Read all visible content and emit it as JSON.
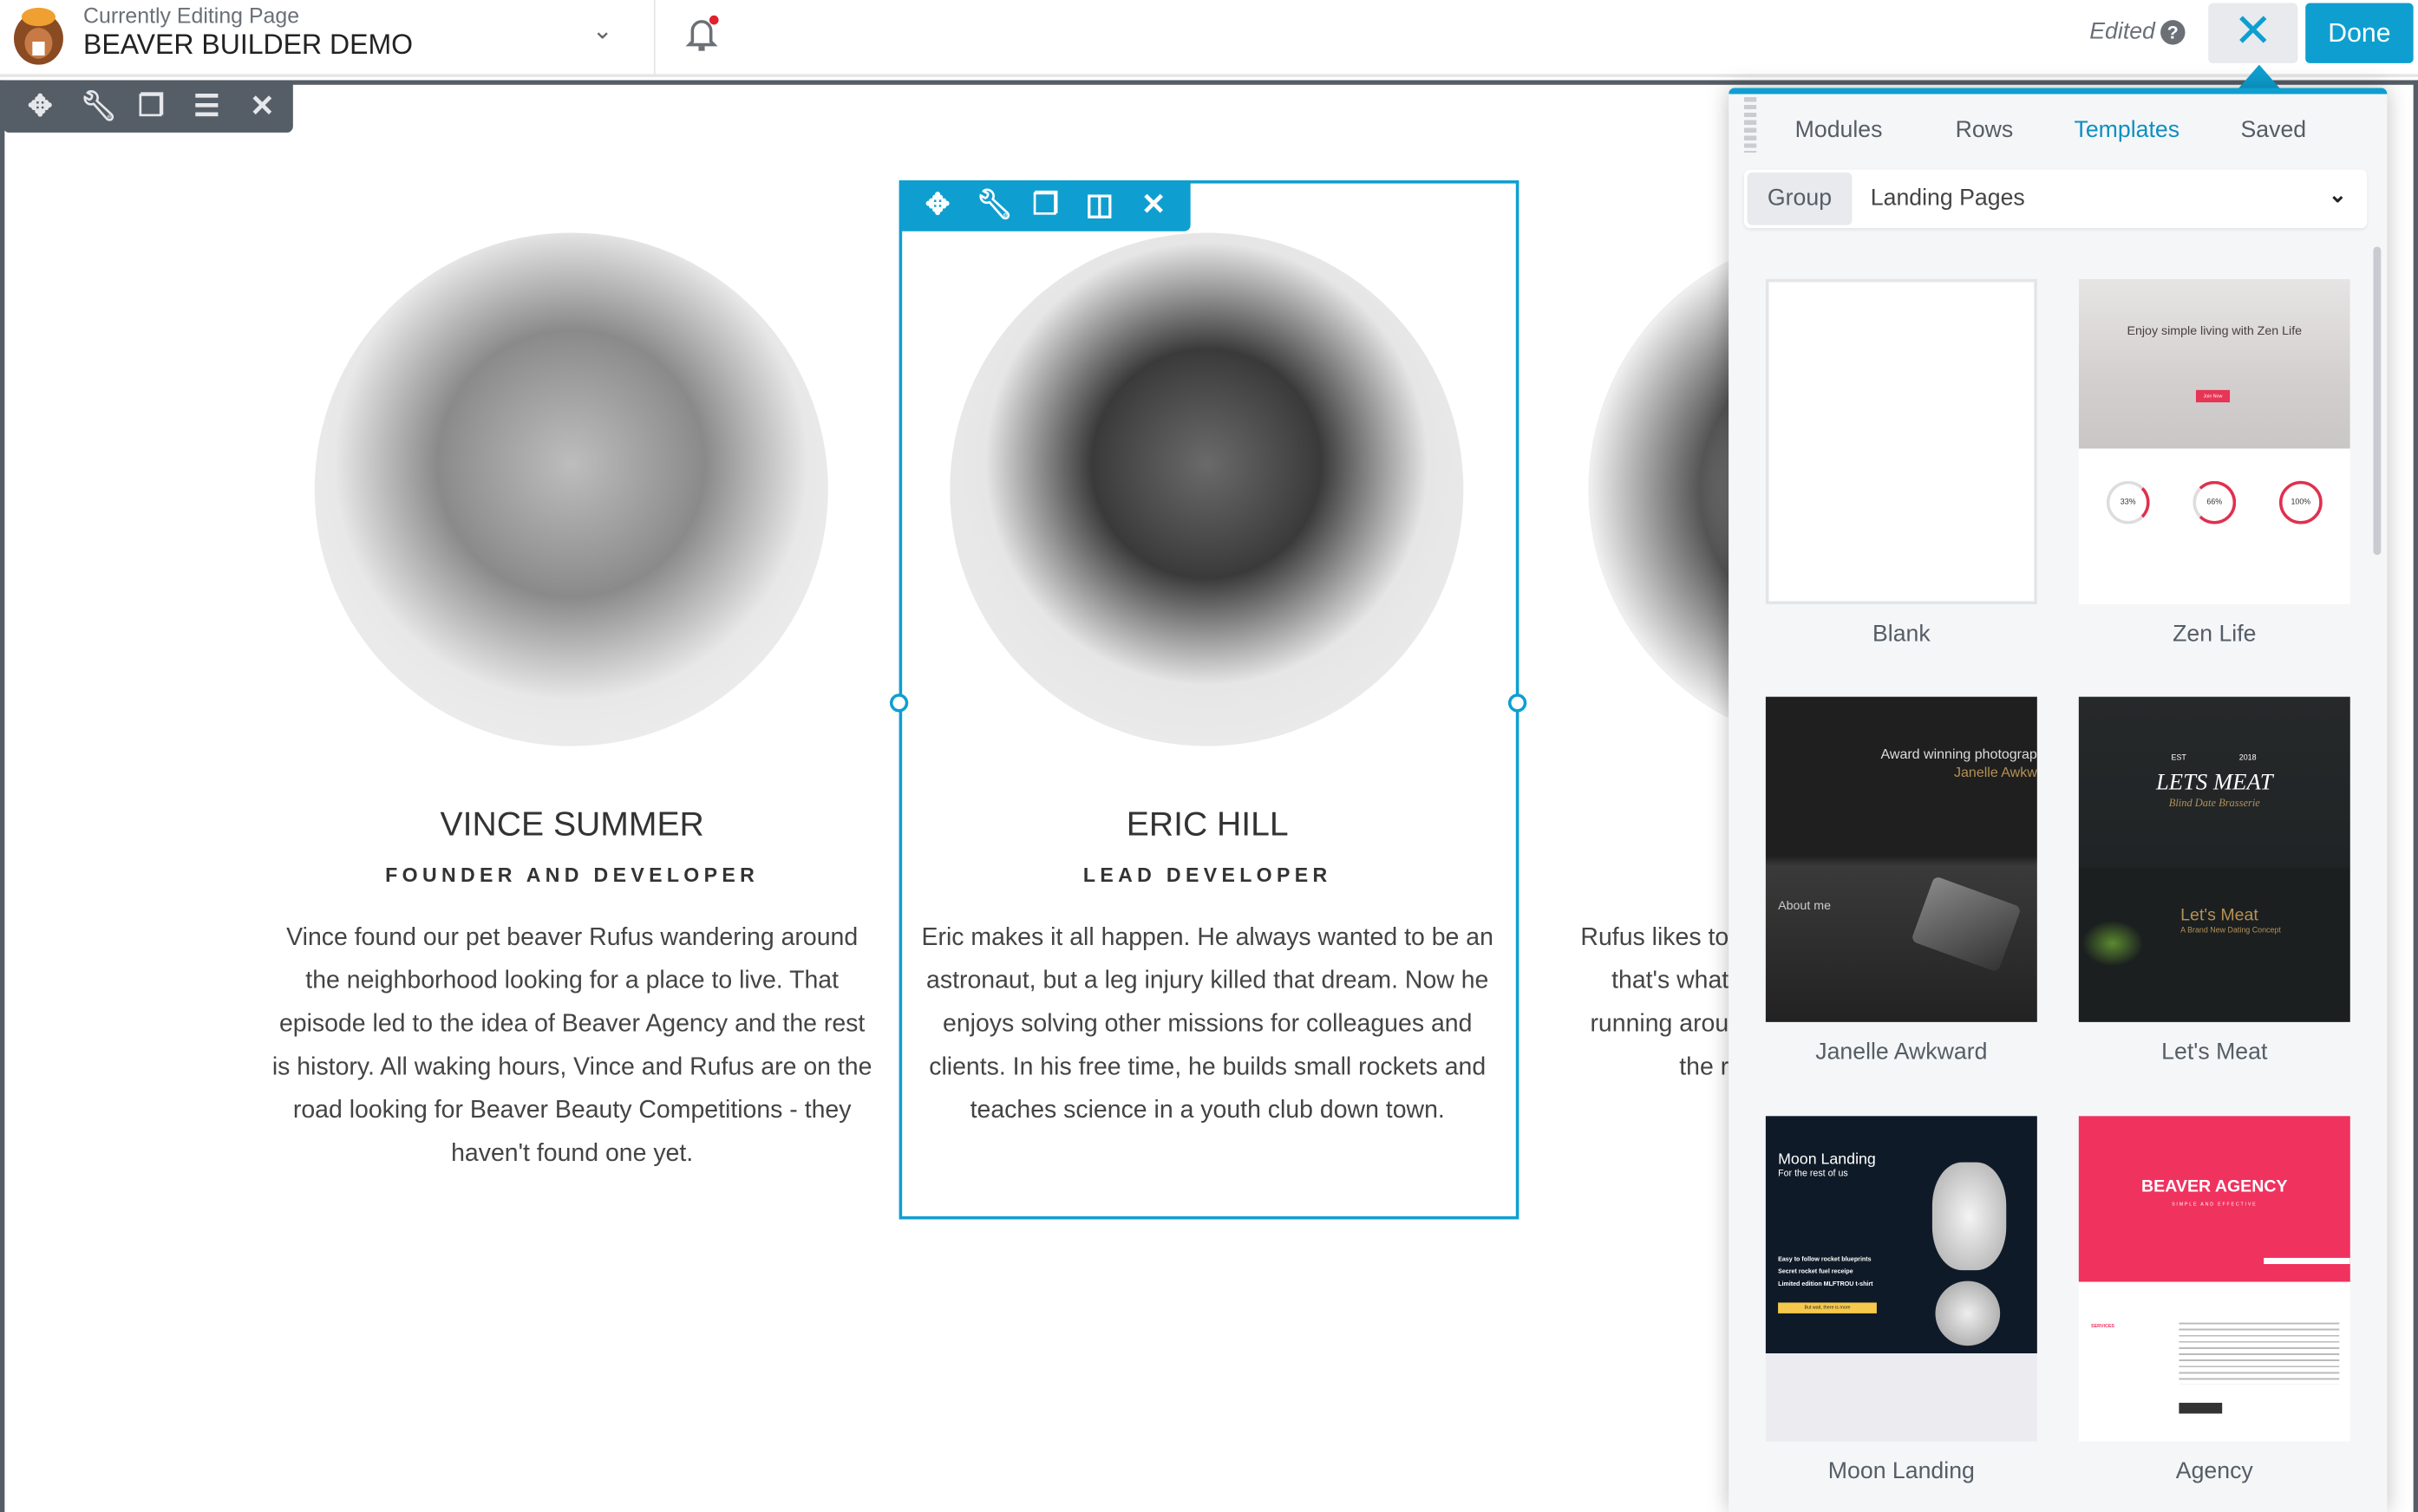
{
  "header": {
    "subtitle": "Currently Editing Page",
    "page_title": "BEAVER BUILDER DEMO",
    "status": "Edited",
    "help_icon": "question-circle-icon",
    "close_label": "✕",
    "done_label": "Done"
  },
  "row_toolbar": [
    "move-icon",
    "wrench-icon",
    "copy-icon",
    "menu-icon",
    "close-icon"
  ],
  "module_toolbar": [
    "move-icon",
    "wrench-icon",
    "copy-icon",
    "columns-icon",
    "close-icon"
  ],
  "team": [
    {
      "name": "VINCE SUMMER",
      "role": "FOUNDER AND DEVELOPER",
      "bio": "Vince found our pet beaver Rufus wandering around the neighborhood looking for a place to live. That episode led to the idea of Beaver Agency and the rest is history. All waking hours, Vince and Rufus are on the road looking for Beaver Beauty Competitions - they haven't found one yet."
    },
    {
      "name": "ERIC HILL",
      "role": "LEAD DEVELOPER",
      "bio": "Eric makes it all happen. He always wanted to be an astronaut, but a leg injury killed that dream. Now he enjoys solving other missions for colleagues and clients. In his free time, he builds small rockets and teaches science in a youth club down town."
    },
    {
      "bio_lines": [
        "Rufus likes to",
        "that's what",
        "running arou",
        "the r"
      ]
    }
  ],
  "panel": {
    "tabs": [
      {
        "label": "Modules"
      },
      {
        "label": "Rows"
      },
      {
        "label": "Templates",
        "active": true
      },
      {
        "label": "Saved"
      }
    ],
    "group_label": "Group",
    "group_value": "Landing Pages",
    "templates": [
      {
        "label": "Blank"
      },
      {
        "label": "Zen Life",
        "headline": "Enjoy simple living with Zen Life",
        "button": "Join Now",
        "stats": [
          "33%",
          "66%",
          "100%"
        ]
      },
      {
        "label": "Janelle Awkward",
        "headline": "Award winning photograp",
        "sub": "Janelle Awkw",
        "section": "About me"
      },
      {
        "label": "Let's Meat",
        "headline": "LETS MEAT",
        "tagline": "Blind Date Brasserie",
        "est": "EST",
        "year": "2018",
        "section": "Let's Meat",
        "sub": "A Brand New Dating Concept"
      },
      {
        "label": "Moon Landing",
        "headline": "Moon Landing",
        "sub": "For the rest of us",
        "items": [
          "Easy to follow rocket blueprints",
          "Secret rocket fuel receipe",
          "Limited edition MLFTROU t-shirt"
        ],
        "button": "But wait, there is more"
      },
      {
        "label": "Agency",
        "headline": "BEAVER AGENCY",
        "sub": "SIMPLE AND EFFECTIVE",
        "section": "SERVICES"
      }
    ]
  },
  "colors": {
    "accent": "#0e9fd0",
    "toolbar": "#555d66",
    "agency": "#f0325f",
    "notification": "#e0202e"
  }
}
